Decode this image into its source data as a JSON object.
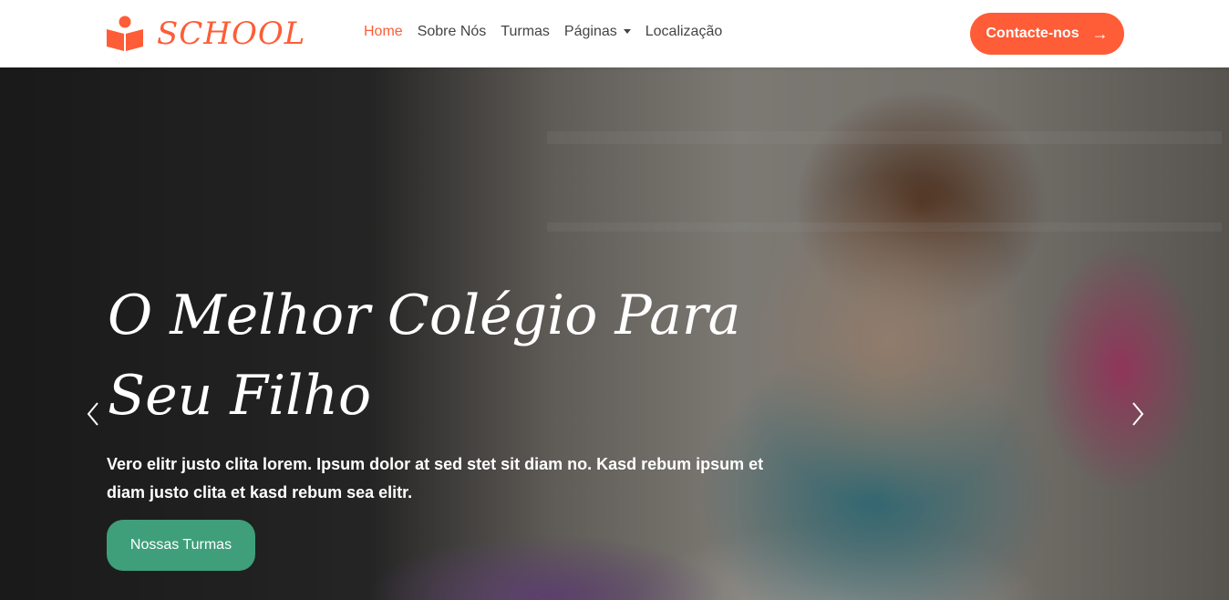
{
  "brand": {
    "name": "SCHOOL",
    "icon": "book-reader-icon",
    "color": "#fe5d37"
  },
  "nav": {
    "items": [
      {
        "label": "Home",
        "active": true
      },
      {
        "label": "Sobre Nós"
      },
      {
        "label": "Turmas"
      },
      {
        "label": "Páginas",
        "dropdown": true
      },
      {
        "label": "Localização"
      }
    ]
  },
  "cta": {
    "label": "Contacte-nos",
    "icon": "arrow-right-icon"
  },
  "hero": {
    "title": "O Melhor Colégio Para Seu Filho",
    "text": "Vero elitr justo clita lorem. Ipsum dolor at sed stet sit diam no. Kasd rebum ipsum et diam justo clita et kasd rebum sea elitr.",
    "button": "Nossas Turmas",
    "button_color": "#3e9f7a",
    "prev_icon": "chevron-left-icon",
    "next_icon": "chevron-right-icon"
  }
}
